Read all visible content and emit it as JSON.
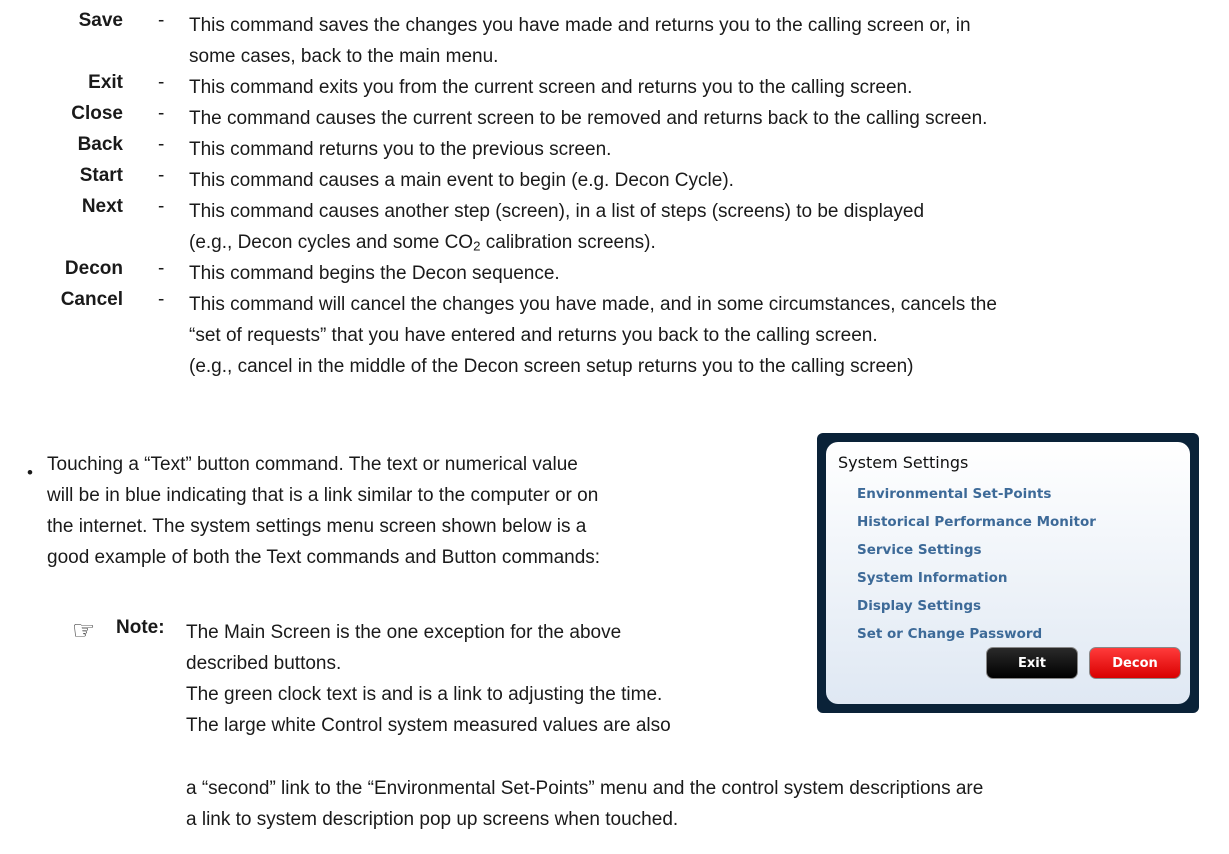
{
  "commands": [
    {
      "term": "Save",
      "lines": [
        "This command saves the changes you have made and returns you to the calling screen or, in",
        "some cases, back to the main menu."
      ]
    },
    {
      "term": "Exit",
      "lines": [
        "This command exits you from the current screen and returns you to the calling screen."
      ]
    },
    {
      "term": "Close",
      "lines": [
        "The command causes the current screen to be removed and returns back to the calling screen."
      ]
    },
    {
      "term": "Back",
      "lines": [
        "This command returns you to the previous screen."
      ]
    },
    {
      "term": "Start",
      "lines": [
        "This command causes a main event to begin (e.g. Decon Cycle)."
      ]
    },
    {
      "term": "Next",
      "lines": [
        "This command causes another step (screen), in a list of steps (screens) to be displayed",
        "(e.g., Decon cycles and some CO",
        "2",
        " calibration screens)."
      ]
    },
    {
      "term": "Decon",
      "lines": [
        "This command begins the Decon sequence."
      ]
    },
    {
      "term": "Cancel",
      "lines": [
        "This command will cancel the changes you have made, and in some circumstances, cancels the",
        "“set of requests” that you have entered and returns you back to the calling screen.",
        "(e.g., cancel in the middle of the Decon screen setup returns you to the calling screen)"
      ]
    }
  ],
  "dash": "-",
  "bullet_symbol": "•",
  "paragraph": [
    "Touching a “Text” button command.  The text or numerical value",
    "will be in blue indicating that is a link similar to the computer or on",
    "the internet.  The system settings menu screen shown below is a",
    "good example of both the Text commands and Button commands:"
  ],
  "note": {
    "icon": "pointing-hand-icon",
    "label": "Note:",
    "lines": [
      "The Main Screen is the one exception for the above",
      "described buttons.",
      "The green clock text is and is a link to adjusting the time.",
      "The large white Control system measured values are also"
    ],
    "continued": [
      "a “second” link to the “Environmental Set-Points” menu and the control system descriptions are",
      "a link to system description pop up screens when touched."
    ]
  },
  "panel": {
    "title": "System Settings",
    "links": [
      "Environmental Set-Points",
      "Historical Performance Monitor",
      "Service Settings",
      "System Information",
      "Display Settings",
      "Set or Change Password"
    ],
    "exit_label": "Exit",
    "decon_label": "Decon",
    "colors": {
      "frame": "#0a2238",
      "link": "#3d6a98",
      "decon": "#ff2020",
      "exit": "#000000"
    }
  }
}
